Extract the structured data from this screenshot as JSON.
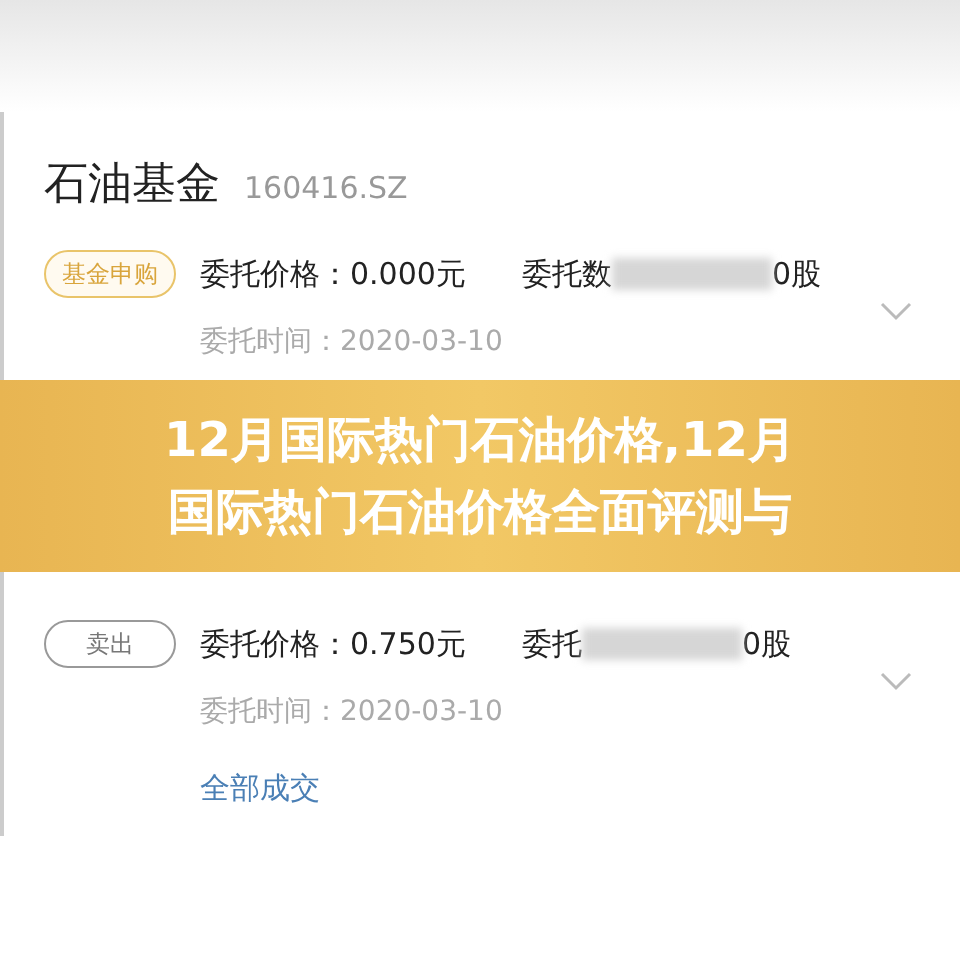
{
  "orders": [
    {
      "fund_name": "石油基金",
      "code": "160416.SZ",
      "badge": {
        "label": "基金申购",
        "kind": "subscribe"
      },
      "price": "委托价格：0.000元",
      "quantity_start": "委托数",
      "quantity_end": "0股",
      "time": "委托时间：2020-03-10"
    },
    {
      "badge": {
        "label": "卖出",
        "kind": "sell"
      },
      "price": "委托价格：0.750元",
      "quantity_start": "委托",
      "quantity_end": "0股",
      "time": "委托时间：2020-03-10",
      "status": "全部成交"
    }
  ],
  "banner": {
    "lines": [
      "12月国际热门石油价格,12月",
      "国际热门石油价格全面评测与"
    ]
  }
}
